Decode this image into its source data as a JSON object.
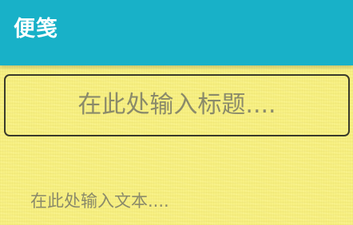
{
  "app_bar": {
    "title": "便笺",
    "background_color": "#18b1c8"
  },
  "note": {
    "paper_color": "#f7f083",
    "title_placeholder": "在此处输入标题....",
    "body_placeholder": "在此处输入文本...."
  }
}
